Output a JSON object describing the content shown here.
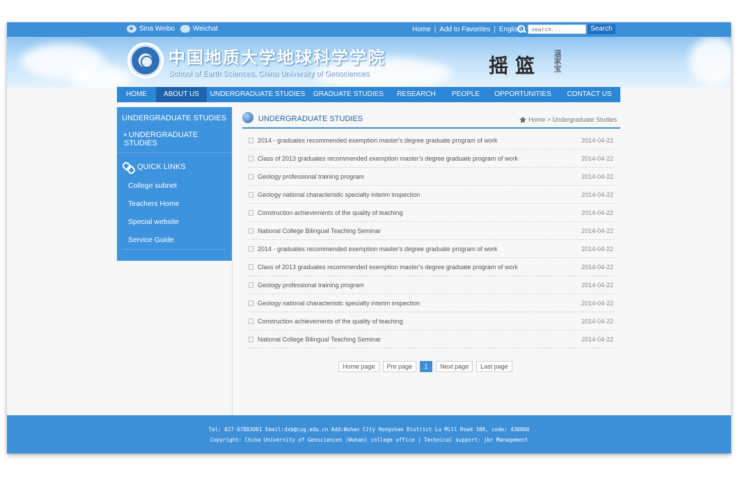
{
  "topbar": {
    "social": [
      {
        "label": "Sina Weibo",
        "icon": "weibo-icon"
      },
      {
        "label": "Weichat",
        "icon": "wechat-icon"
      }
    ],
    "links": [
      "Home",
      "Add to Favorites",
      "English"
    ],
    "search_placeholder": "search...",
    "search_button": "Search"
  },
  "banner": {
    "cn_title": "中国地质大学地球科学学院",
    "en_title": "School of Earth Sciences, China University of Geosciences",
    "calligraphy": "摇篮",
    "calligraphy_small": "温家宝"
  },
  "nav": {
    "items": [
      "HOME",
      "ABOUT US",
      "UNDERGRADUATE STUDIES",
      "GRADUATE STUDIES",
      "RESEARCH",
      "PEOPLE",
      "OPPORTUNITIES",
      "CONTACT US"
    ],
    "active_index": 1
  },
  "sidebar": {
    "heading": "UNDERGRADUATE STUDIES",
    "sub_item": "• UNDERGRADUATE STUDIES",
    "quick_links_title": "QUICK LINKS",
    "links": [
      "College subnet",
      "Teachers Home",
      "Special website",
      "Service Guide"
    ]
  },
  "content": {
    "title": "UNDERGRADUATE STUDIES",
    "breadcrumb": "Home > Undergraduate Studies",
    "rows": [
      {
        "text": "2014 - graduates recommended exemption master's degree graduate program of work",
        "date": "2014-04-22"
      },
      {
        "text": "Class of 2013 graduates recommended exemption master's degree graduate program of work",
        "date": "2014-04-22"
      },
      {
        "text": "Geology professional training program",
        "date": "2014-04-22"
      },
      {
        "text": "Geology national characteristic specialty interim inspection",
        "date": "2014-04-22"
      },
      {
        "text": "Construction achievements of the quality of teaching",
        "date": "2014-04-22"
      },
      {
        "text": "National College Bilingual Teaching Seminar",
        "date": "2014-04-22"
      },
      {
        "text": "2014 - graduates recommended exemption master's degree graduate program of work",
        "date": "2014-04-22"
      },
      {
        "text": "Class of 2013 graduates recommended exemption master's degree graduate program of work",
        "date": "2014-04-22"
      },
      {
        "text": "Geology professional training program",
        "date": "2014-04-22"
      },
      {
        "text": "Geology national characteristic specialty interim inspection",
        "date": "2014-04-22"
      },
      {
        "text": "Construction achievements of the quality of teaching",
        "date": "2014-04-22"
      },
      {
        "text": "National College Bilingual Teaching Seminar",
        "date": "2014-04-22"
      }
    ]
  },
  "pager": {
    "first": "Home page",
    "prev": "Pre page",
    "current": "1",
    "next": "Next page",
    "last": "Last page"
  },
  "footer": {
    "line1": "Tel: 027-67883001 Email:dxb@cug.edu.cn Add:Wuhan City Hongshan District Lu Mill Road 388, code: 430060",
    "line2": "Copyright: China University of Geosciences (Wuhan) college office | Technical support: jbr Management"
  },
  "colors": {
    "primary": "#3d8fd8",
    "nav_active": "#1d64ac",
    "sidebar": "#3d93de"
  }
}
